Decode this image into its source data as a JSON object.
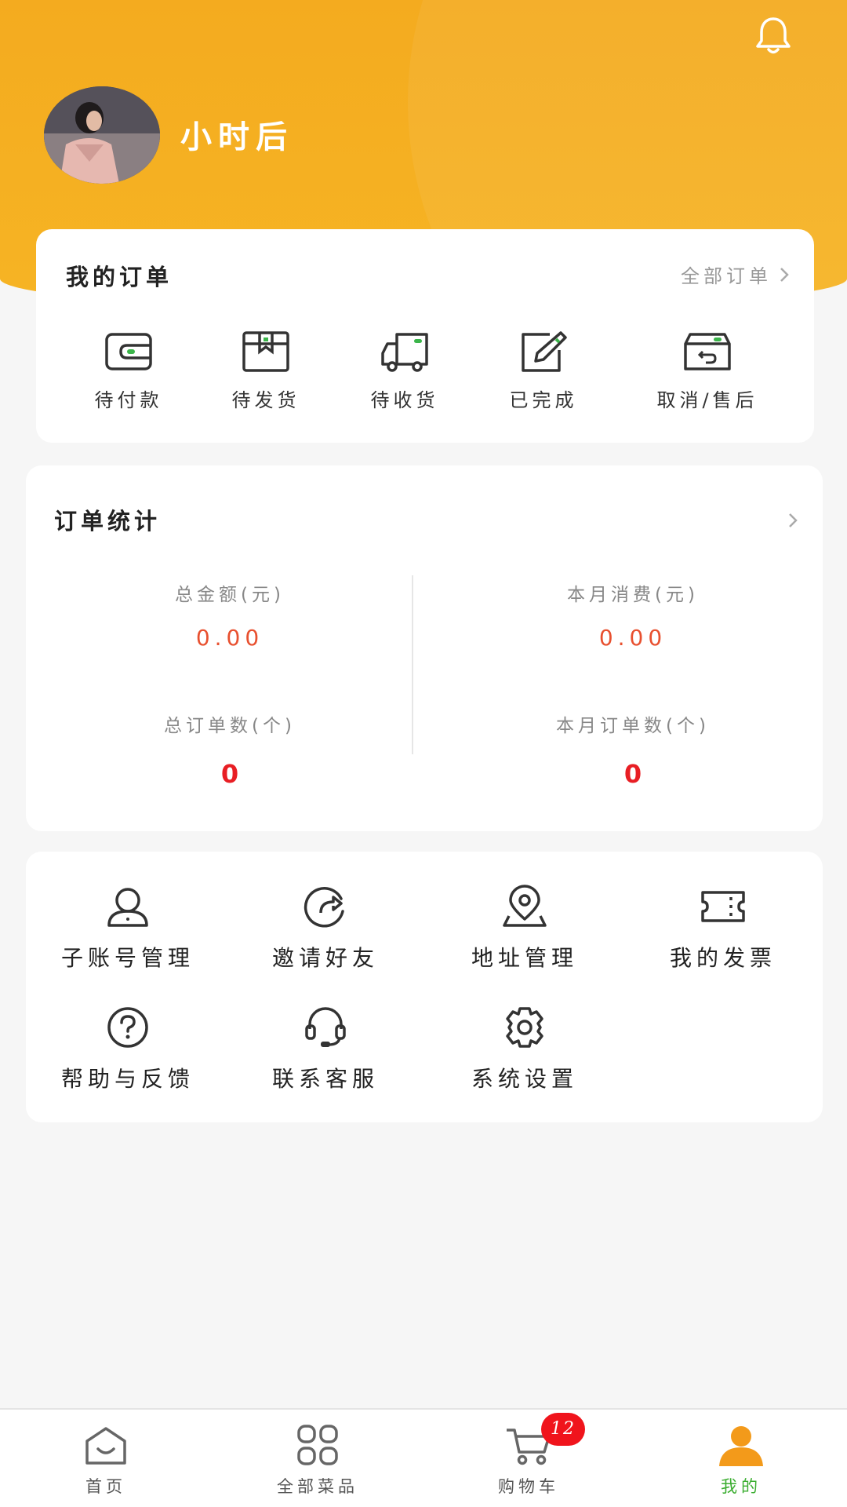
{
  "profile": {
    "username": "小时后"
  },
  "orders": {
    "title": "我的订单",
    "all_orders_label": "全部订单",
    "items": [
      {
        "label": "待付款",
        "icon": "wallet-icon"
      },
      {
        "label": "待发货",
        "icon": "package-icon"
      },
      {
        "label": "待收货",
        "icon": "delivery-truck-icon"
      },
      {
        "label": "已完成",
        "icon": "edit-check-icon"
      },
      {
        "label": "取消/售后",
        "icon": "return-box-icon"
      }
    ]
  },
  "stats": {
    "title": "订单统计",
    "total_amount_label": "总金额(元)",
    "total_amount_value": "0.00",
    "month_spend_label": "本月消费(元)",
    "month_spend_value": "0.00",
    "total_orders_label": "总订单数(个)",
    "total_orders_value": "0",
    "month_orders_label": "本月订单数(个)",
    "month_orders_value": "0"
  },
  "menu": {
    "items": [
      {
        "label": "子账号管理",
        "icon": "user-icon"
      },
      {
        "label": "邀请好友",
        "icon": "share-icon"
      },
      {
        "label": "地址管理",
        "icon": "location-pin-icon"
      },
      {
        "label": "我的发票",
        "icon": "ticket-icon"
      },
      {
        "label": "帮助与反馈",
        "icon": "help-icon"
      },
      {
        "label": "联系客服",
        "icon": "headset-icon"
      },
      {
        "label": "系统设置",
        "icon": "gear-icon"
      }
    ]
  },
  "tabbar": {
    "items": [
      {
        "label": "首页",
        "icon": "home-icon"
      },
      {
        "label": "全部菜品",
        "icon": "grid-icon"
      },
      {
        "label": "购物车",
        "icon": "cart-icon"
      },
      {
        "label": "我的",
        "icon": "profile-icon"
      }
    ],
    "cart_badge": "12",
    "active_index": 3
  },
  "colors": {
    "header": "#f4ab1f",
    "money": "#e8502f",
    "count": "#e81e24",
    "active_tab": "#3aad2f",
    "badge": "#f0141c"
  }
}
